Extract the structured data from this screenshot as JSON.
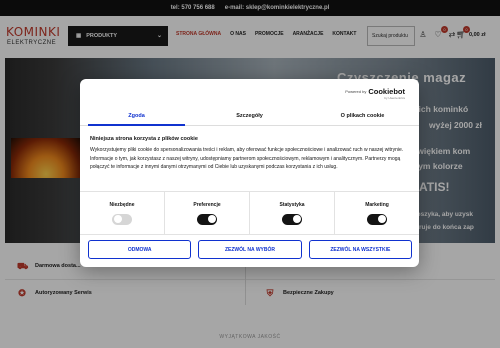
{
  "topbar": {
    "phone": "tel: 570 756 688",
    "email": "e-mail: sklep@kominkielektryczne.pl"
  },
  "logo": {
    "line1": "KOMINKI",
    "line2": "ELEKTRYCZNE"
  },
  "header": {
    "products_label": "PRODUKTY",
    "nav": [
      "STRONA GŁÓWNA",
      "O NAS",
      "PROMOCJE",
      "ARANŻACJE",
      "KONTAKT"
    ],
    "search_placeholder": "Szukaj produktu",
    "wishlist_count": "0",
    "compare_count": "0",
    "cart_count": "0",
    "cart_total": "0,00 zł"
  },
  "hero": {
    "line1": "Czyszczenie magaz",
    "line2": "tkich kominkó",
    "line3": "wyżej 2000 zł",
    "line4": "zwiękiem kom",
    "line5": "nym kolorze",
    "line6": "ATIS!",
    "line7": "koszyka, aby uzysk",
    "line8": "ruje do końca zap"
  },
  "features": {
    "shipping": "Darmowa dosta...",
    "service": "Autoryzowany Serwis",
    "secure": "Bezpieczne Zakupy"
  },
  "why_title": "WYJĄTKOWA JAKOŚĆ",
  "cookie": {
    "powered_by": "Powered by",
    "brand": "Cookiebot",
    "brand_sub": "by Usercentrics",
    "tabs": [
      "Zgoda",
      "Szczegóły",
      "O plikach cookie"
    ],
    "title": "Niniejsza strona korzysta z plików cookie",
    "body": "Wykorzystujemy pliki cookie do spersonalizowania treści i reklam, aby oferować funkcje społecznościowe i analizować ruch w naszej witrynie. Informacje o tym, jak korzystasz z naszej witryny, udostępniamy partnerom społecznościowym, reklamowym i analitycznym. Partnerzy mogą połączyć te informacje z innymi danymi otrzymanymi od Ciebie lub uzyskanymi podczas korzystania z ich usług.",
    "toggles": [
      {
        "label": "Niezbędne",
        "on": true,
        "disabled": true
      },
      {
        "label": "Preferencje",
        "on": true
      },
      {
        "label": "Statystyka",
        "on": true
      },
      {
        "label": "Marketing",
        "on": true
      }
    ],
    "buttons": [
      "ODMOWA",
      "ZEZWÓL NA WYBÓR",
      "ZEZWÓL NA WSZYSTKIE"
    ],
    "accent_color": "#1032cf"
  }
}
